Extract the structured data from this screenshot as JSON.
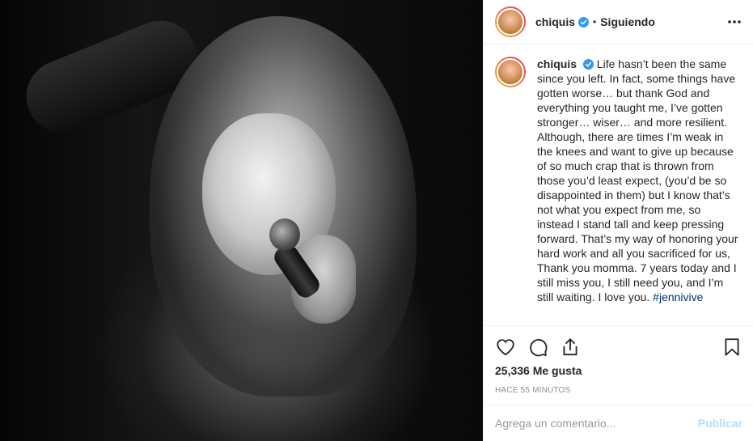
{
  "post": {
    "author": {
      "username": "chiquis",
      "verified": true,
      "follow_status": "Siguiendo",
      "separator": "•"
    },
    "photo": {
      "description_icon": "post-photo"
    },
    "caption": {
      "username": "chiquis",
      "text": "Life hasn’t been the same since you left. In fact, some things have gotten worse… but thank God and everything you taught me, I’ve gotten stronger… wiser… and more resilient. Although, there are times I’m weak in the knees and want to give up because of so much crap that is thrown from those you’d least expect, (you’d be so disappointed in them) but I know that’s not what you expect from me, so instead I stand tall and keep pressing forward. That’s my way of honoring your hard work and all you sacrificed for us, Thank you momma. 7 years today and I still miss you, I still need you, and I’m still waiting. I love you.",
      "hashtag": "#jennivive"
    },
    "likes": "25,336 Me gusta",
    "timestamp": "Hace 55 minutos",
    "comment_input": {
      "placeholder": "Agrega un comentario...",
      "value": ""
    },
    "publish_label": "Publicar",
    "icons": {
      "like": "heart-icon",
      "comment": "comment-icon",
      "share": "share-icon",
      "save": "bookmark-icon",
      "more": "more-options-icon",
      "verified": "verified-badge-icon"
    },
    "colors": {
      "verified": "#3897f0",
      "hashtag": "#003569",
      "publish_disabled": "#b2dffc",
      "muted_text": "#8e8e8e"
    }
  }
}
